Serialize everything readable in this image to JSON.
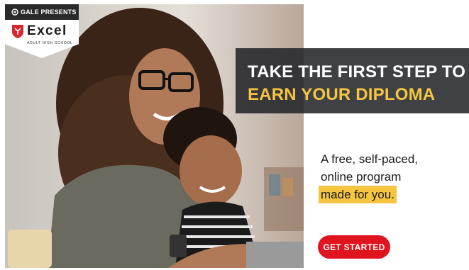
{
  "badge": {
    "presenter": "GALE PRESENTS",
    "brand": "Excel",
    "brand_subtitle": "ADULT HIGH SCHOOL",
    "icon": "shield-icon"
  },
  "headline": {
    "line1": "TAKE THE FIRST STEP TO",
    "line2": "EARN YOUR DIPLOMA"
  },
  "subcopy": {
    "line1": "A free, self-paced,",
    "line2": "online program",
    "line3_highlight": "made for you."
  },
  "cta": {
    "label": "GET STARTED"
  },
  "colors": {
    "accent_yellow": "#f5c542",
    "cta_red": "#e0141e",
    "band_dark": "#202226",
    "shield_red": "#d7262e"
  },
  "image": {
    "description_icon": "photo-woman-and-child-at-laptop"
  }
}
